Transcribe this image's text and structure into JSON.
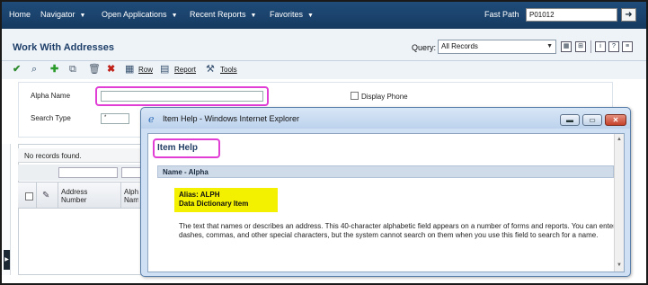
{
  "topnav": {
    "items": [
      "Home",
      "Navigator",
      "Open Applications",
      "Recent Reports",
      "Favorites"
    ],
    "fastpath_label": "Fast Path",
    "fastpath_value": "P01012"
  },
  "form": {
    "title": "Work With Addresses",
    "query_label": "Query:",
    "query_value": "All Records"
  },
  "toolbar": {
    "row_label": "Row",
    "report_label": "Report",
    "tools_label": "Tools"
  },
  "search": {
    "alpha_name_label": "Alpha Name",
    "display_phone_label": "Display Phone",
    "search_type_label": "Search Type",
    "search_type_value": "*"
  },
  "grid": {
    "no_records": "No records found.",
    "col_address_number": "Address Number",
    "col_alpha_name_partial": "Alph Nam"
  },
  "popup": {
    "window_title": "Item Help - Windows Internet Explorer",
    "heading": "Item Help",
    "name_line": "Name - Alpha",
    "alias_line": "Alias: ALPH",
    "dd_line": "Data Dictionary Item",
    "description": "The text that names or describes an address. This 40-character alphabetic field appears on a number of forms and reports. You can enter dashes, commas, and other special characters, but the system cannot search on them when you use this field to search for a name."
  },
  "colors": {
    "nav_bg": "#1f4c7a",
    "highlight": "#e13ed6",
    "alias_bg": "#f3f000",
    "title_color": "#1d3e68"
  }
}
